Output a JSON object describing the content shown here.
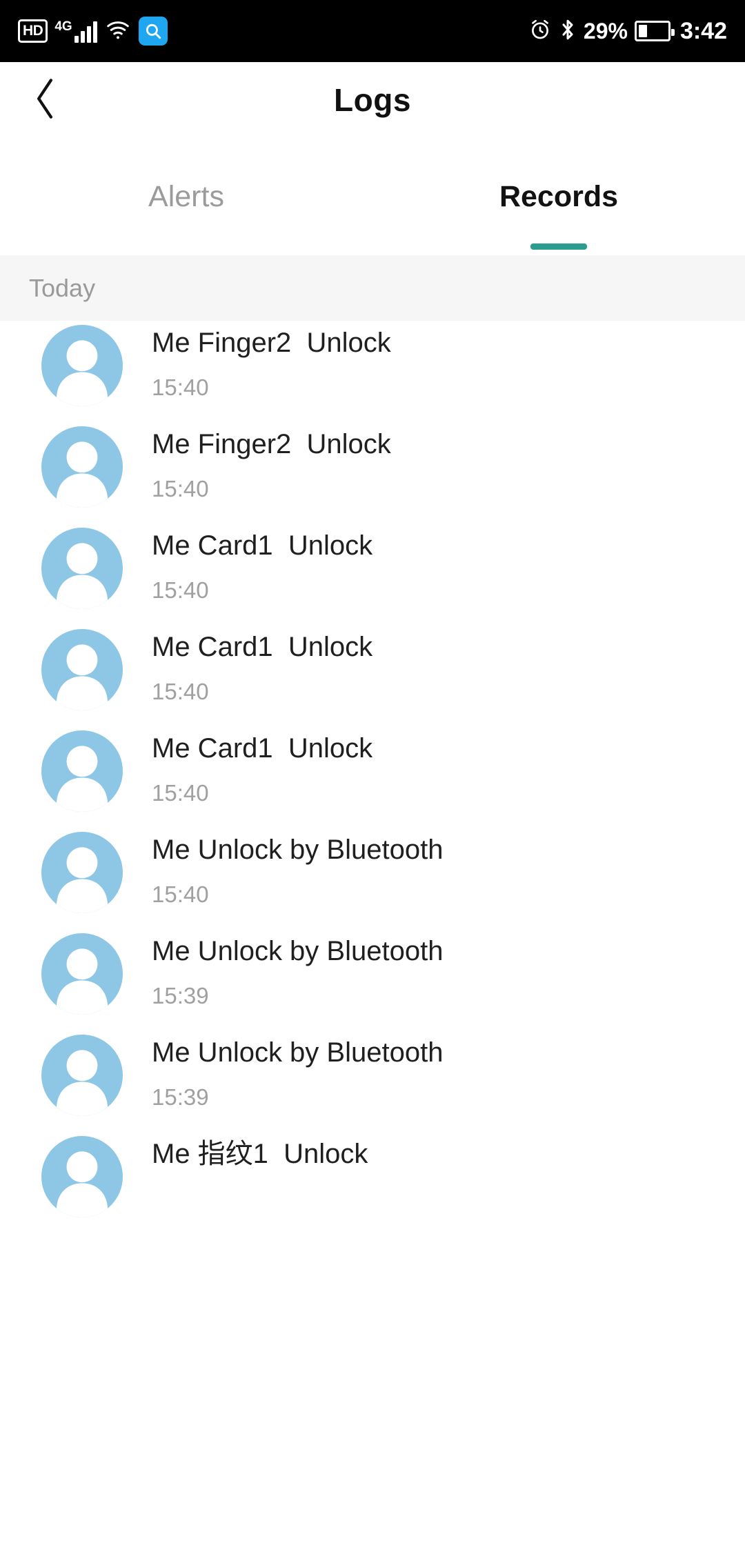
{
  "status_bar": {
    "hd_label": "HD",
    "network_label": "4G",
    "signal_icon": "signal-bars-icon",
    "wifi_icon": "wifi-icon",
    "search_icon": "search-icon",
    "alarm_icon": "alarm-clock-icon",
    "bluetooth_icon": "bluetooth-icon",
    "battery_percent": "29%",
    "battery_icon": "battery-icon",
    "clock": "3:42",
    "battery_level": 29
  },
  "nav": {
    "back_icon": "back-chevron-icon",
    "title": "Logs"
  },
  "tabs": [
    {
      "label": "Alerts",
      "active": false
    },
    {
      "label": "Records",
      "active": true
    }
  ],
  "colors": {
    "accent": "#2a9d8f",
    "avatar_blue": "#8ec7e6",
    "section_band": "#f6f6f6",
    "title_text": "#1f1f1f",
    "time_text": "#a0a0a0"
  },
  "sections": [
    {
      "header": "Today",
      "records": [
        {
          "title": "Me Finger2  Unlock",
          "time": "15:40",
          "avatar_icon": "user-avatar-icon"
        },
        {
          "title": "Me Finger2  Unlock",
          "time": "15:40",
          "avatar_icon": "user-avatar-icon"
        },
        {
          "title": "Me Card1  Unlock",
          "time": "15:40",
          "avatar_icon": "user-avatar-icon"
        },
        {
          "title": "Me Card1  Unlock",
          "time": "15:40",
          "avatar_icon": "user-avatar-icon"
        },
        {
          "title": "Me Card1  Unlock",
          "time": "15:40",
          "avatar_icon": "user-avatar-icon"
        },
        {
          "title": "Me Unlock by Bluetooth",
          "time": "15:40",
          "avatar_icon": "user-avatar-icon"
        },
        {
          "title": "Me Unlock by Bluetooth",
          "time": "15:39",
          "avatar_icon": "user-avatar-icon"
        },
        {
          "title": "Me Unlock by Bluetooth",
          "time": "15:39",
          "avatar_icon": "user-avatar-icon"
        },
        {
          "title": "Me 指纹1  Unlock",
          "time": "",
          "avatar_icon": "user-avatar-icon"
        }
      ]
    }
  ]
}
